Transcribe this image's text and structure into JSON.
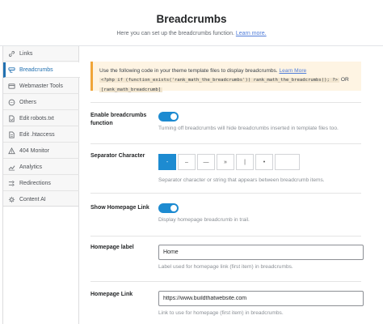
{
  "header": {
    "title": "Breadcrumbs",
    "subtitle": "Here you can set up the breadcrumbs function.",
    "learn_more": "Learn more."
  },
  "sidebar": {
    "items": [
      {
        "label": "Links",
        "icon": "link-icon"
      },
      {
        "label": "Breadcrumbs",
        "icon": "breadcrumbs-icon",
        "active": true
      },
      {
        "label": "Webmaster Tools",
        "icon": "webmaster-icon"
      },
      {
        "label": "Others",
        "icon": "others-icon"
      },
      {
        "label": "Edit robots.txt",
        "icon": "robots-icon"
      },
      {
        "label": "Edit .htaccess",
        "icon": "htaccess-icon"
      },
      {
        "label": "404 Monitor",
        "icon": "monitor-icon"
      },
      {
        "label": "Analytics",
        "icon": "analytics-icon"
      },
      {
        "label": "Redirections",
        "icon": "redirections-icon"
      },
      {
        "label": "Content AI",
        "icon": "content-ai-icon"
      }
    ]
  },
  "notice": {
    "text": "Use the following code in your theme template files to display breadcrumbs.",
    "learn_more": "Learn More",
    "code1": "<?php if (function_exists('rank_math_the_breadcrumbs')) rank_math_the_breadcrumbs(); ?>",
    "or": "OR",
    "code2": "[rank_math_breadcrumb]"
  },
  "fields": {
    "enable": {
      "label": "Enable breadcrumbs function",
      "desc": "Turning off breadcrumbs will hide breadcrumbs inserted in template files too.",
      "enabled": true
    },
    "separator": {
      "label": "Separator Character",
      "options": [
        "-",
        "–",
        "—",
        "»",
        "|",
        "•"
      ],
      "selected": "-",
      "desc": "Separator character or string that appears between breadcrumb items."
    },
    "homepage_link": {
      "label": "Show Homepage Link",
      "desc": "Display homepage breadcrumb in trail.",
      "enabled": true
    },
    "homepage_label": {
      "label": "Homepage label",
      "value": "Home",
      "desc": "Label used for homepage link (first item) in breadcrumbs."
    },
    "homepage_url": {
      "label": "Homepage Link",
      "value": "https://www.buildthatwebsite.com",
      "desc": "Link to use for homepage (first item) in breadcrumbs."
    }
  },
  "colors": {
    "accent": "#1d8bd1",
    "notice_bg": "#fef4e3",
    "notice_border": "#f0a538"
  }
}
